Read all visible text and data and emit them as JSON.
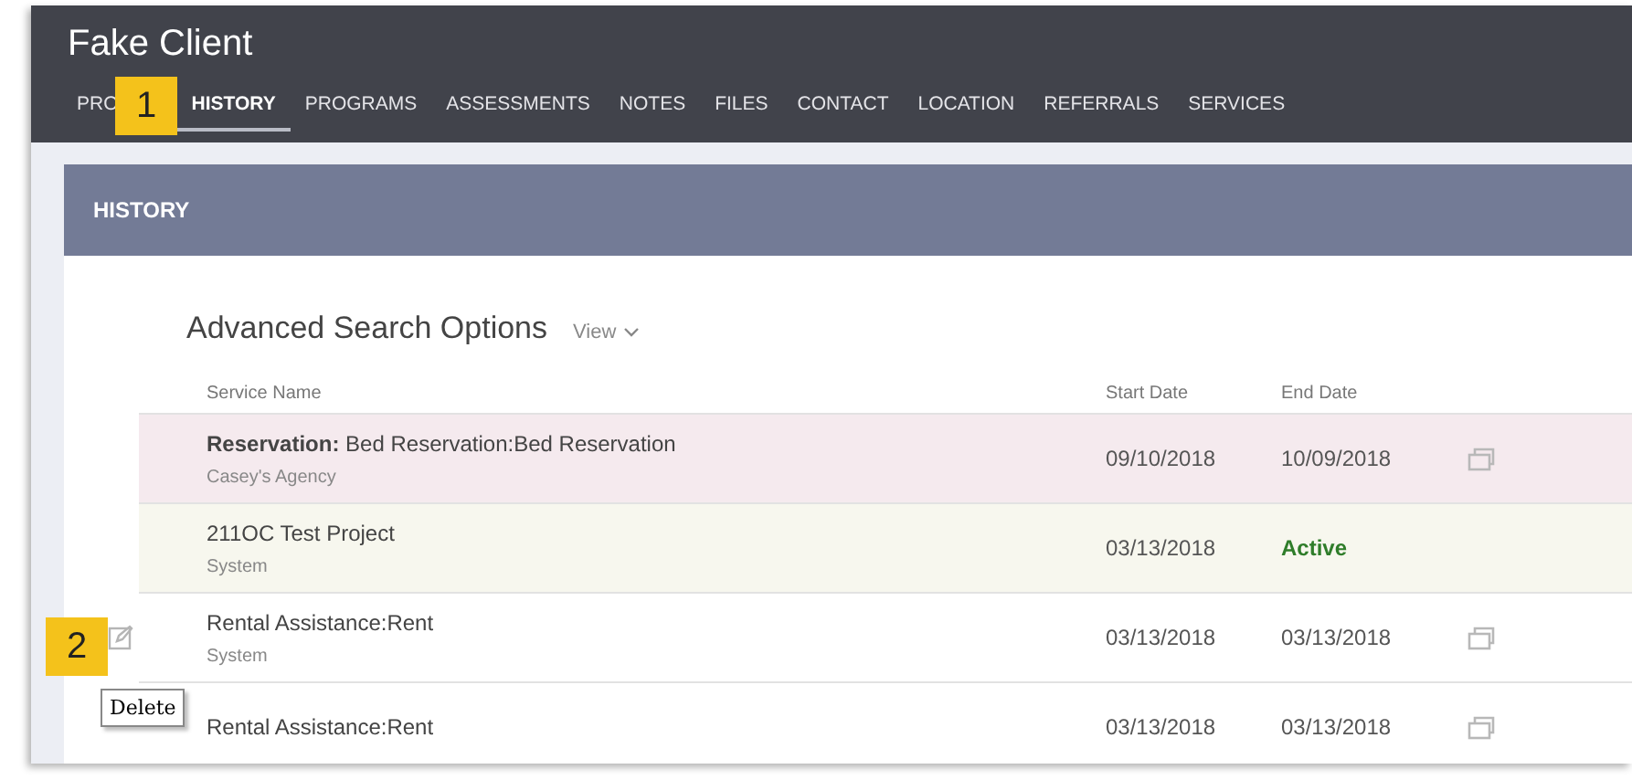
{
  "client": {
    "name": "Fake Client"
  },
  "tabs": [
    {
      "label": "PRO",
      "selected": false
    },
    {
      "label": "HISTORY",
      "selected": true
    },
    {
      "label": "PROGRAMS",
      "selected": false
    },
    {
      "label": "ASSESSMENTS",
      "selected": false
    },
    {
      "label": "NOTES",
      "selected": false
    },
    {
      "label": "FILES",
      "selected": false
    },
    {
      "label": "CONTACT",
      "selected": false
    },
    {
      "label": "LOCATION",
      "selected": false
    },
    {
      "label": "REFERRALS",
      "selected": false
    },
    {
      "label": "SERVICES",
      "selected": false
    }
  ],
  "panel": {
    "title": "HISTORY",
    "search_heading": "Advanced Search Options",
    "view_button": "View"
  },
  "table": {
    "columns": [
      "Service Name",
      "Start Date",
      "End Date"
    ],
    "rows": [
      {
        "name": "**Reservation:** Bed Reservation:Bed Reservation",
        "source": "Casey's Agency",
        "start": "09/10/2018",
        "end": "10/09/2018",
        "active": false,
        "color": "#f5eaee",
        "copy_icon": true,
        "edit_icon": false
      },
      {
        "name": "211OC Test Project",
        "source": "System",
        "start": "03/13/2018",
        "end": "Active",
        "active": true,
        "color": "#f7f7ee",
        "copy_icon": false,
        "edit_icon": false
      },
      {
        "name": "Rental Assistance:Rent",
        "source": "System",
        "start": "03/13/2018",
        "end": "03/13/2018",
        "active": false,
        "color": "#ffffff",
        "copy_icon": true,
        "edit_icon": true
      },
      {
        "name": "Rental Assistance:Rent",
        "start": "03/13/2018",
        "end": "03/13/2018",
        "active": false,
        "color": "#ffffff",
        "copy_icon": true,
        "edit_icon": false
      }
    ]
  },
  "tooltip": "Delete",
  "callouts": [
    "1",
    "2"
  ]
}
